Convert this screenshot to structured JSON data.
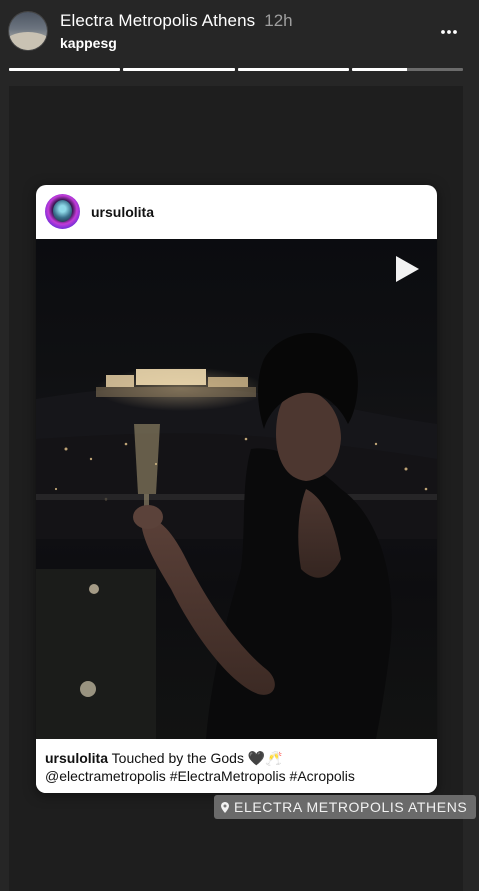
{
  "header": {
    "title": "Electra Metropolis Athens",
    "time": "12h",
    "username": "kappesg",
    "avatar_icon": "hotel-terrace-avatar",
    "more_icon": "more-horizontal-icon"
  },
  "progress": [
    1,
    1,
    1,
    0.5
  ],
  "card": {
    "username": "ursulolita",
    "avatar_icon": "profile-photo-avatar",
    "play_icon": "play-icon",
    "caption_user": "ursulolita",
    "caption_text": "Touched by the Gods 🖤🥂",
    "caption_line2": "@electrametropolis #ElectraMetropolis #Acropolis"
  },
  "location_sticker": {
    "label": "ELECTRA METROPOLIS ATHENS",
    "icon": "location-pin-icon"
  },
  "colors": {
    "background": "#262626",
    "text": "#ffffff",
    "muted": "#9e9e9e"
  }
}
